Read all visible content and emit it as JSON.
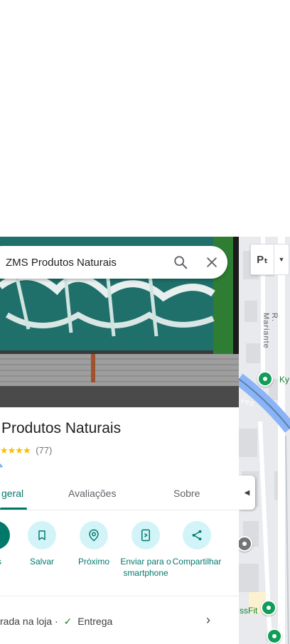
{
  "search": {
    "query": "ZMS Produtos Naturais"
  },
  "place": {
    "title": "Produtos Naturais",
    "stars": "★★★★",
    "review_count": "(77)"
  },
  "tabs": [
    {
      "label": "geral"
    },
    {
      "label": "Avaliações"
    },
    {
      "label": "Sobre"
    }
  ],
  "actions": [
    {
      "label": "s"
    },
    {
      "label": "Salvar"
    },
    {
      "label": "Próximo"
    },
    {
      "label": "Enviar para o smartphone"
    },
    {
      "label": "Compartilhar"
    }
  ],
  "services": {
    "pickup": "rada na loja ·",
    "delivery": "Entrega"
  },
  "map": {
    "road_label_1": "R. Mariante",
    "road_label_2": "ves",
    "poi_label_1": "Ky",
    "poi_label_2": "ssFit",
    "layer_label": "Pₜ"
  },
  "colors": {
    "accent": "#00796b",
    "action_bg": "#d2f4f8",
    "star": "#fbbc04"
  }
}
